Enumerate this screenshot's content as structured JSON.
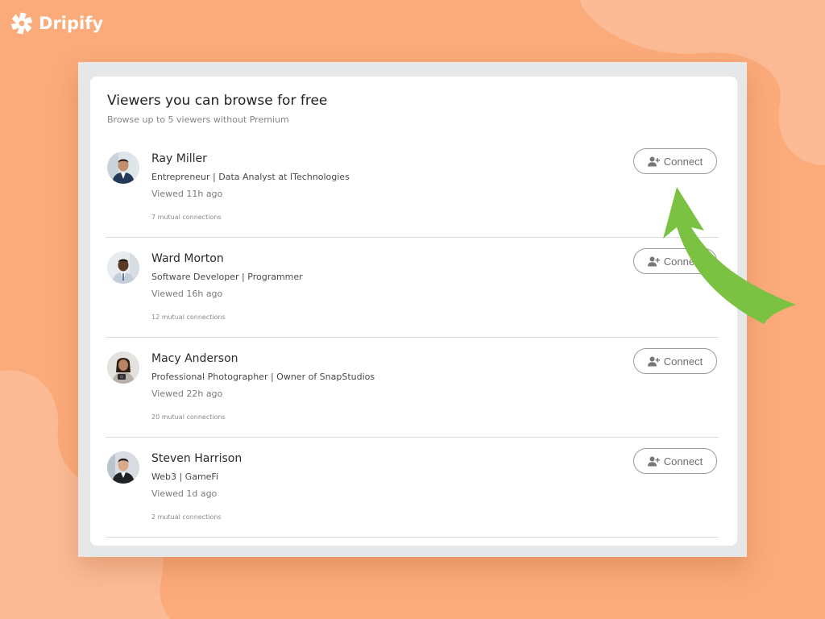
{
  "brand": {
    "name": "Dripify",
    "icon": "aperture-logo-icon",
    "color": "#ffffff"
  },
  "colors": {
    "background": "#fbaa7a",
    "accent_arrow": "#7cc242",
    "card": "#ffffff"
  },
  "panel": {
    "title": "Viewers you can browse for free",
    "subtitle": "Browse up to 5 viewers without Premium"
  },
  "viewers": [
    {
      "name": "Ray Miller",
      "headline": "Entrepreneur | Data Analyst at ITechnologies",
      "viewed": "Viewed 11h ago",
      "mutual": "7 mutual connections",
      "connect_label": "Connect",
      "connect_icon": "add-person-icon"
    },
    {
      "name": "Ward Morton",
      "headline": "Software Developer | Programmer",
      "viewed": "Viewed 16h ago",
      "mutual": "12 mutual connections",
      "connect_label": "Connect",
      "connect_icon": "add-person-icon"
    },
    {
      "name": "Macy Anderson",
      "headline": "Professional Photographer | Owner of SnapStudios",
      "viewed": "Viewed 22h ago",
      "mutual": "20 mutual connections",
      "connect_label": "Connect",
      "connect_icon": "add-person-icon"
    },
    {
      "name": "Steven Harrison",
      "headline": "Web3 | GameFi",
      "viewed": "Viewed 1d ago",
      "mutual": "2 mutual connections",
      "connect_label": "Connect",
      "connect_icon": "add-person-icon"
    }
  ]
}
